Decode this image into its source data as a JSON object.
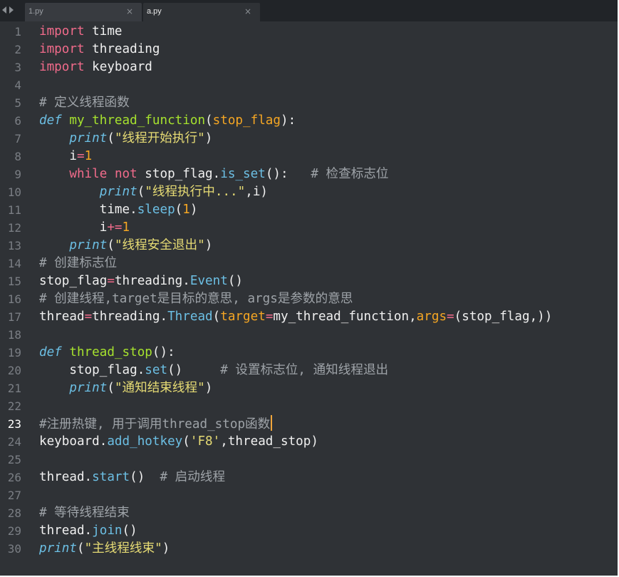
{
  "tabs": [
    {
      "label": "1.py",
      "close": "×"
    },
    {
      "label": "a.py",
      "close": "×"
    }
  ],
  "current_line": "23",
  "lines": {
    "l1": {
      "n": "1",
      "t": [
        [
          "kw",
          "import"
        ],
        [
          "pl",
          " time"
        ]
      ]
    },
    "l2": {
      "n": "2",
      "t": [
        [
          "kw",
          "import"
        ],
        [
          "pl",
          " threading"
        ]
      ]
    },
    "l3": {
      "n": "3",
      "t": [
        [
          "kw",
          "import"
        ],
        [
          "pl",
          " keyboard"
        ]
      ]
    },
    "l4": {
      "n": "4",
      "t": []
    },
    "l5": {
      "n": "5",
      "t": [
        [
          "cm",
          "# 定义线程函数"
        ]
      ]
    },
    "l6": {
      "n": "6",
      "t": [
        [
          "def",
          "def"
        ],
        [
          "pl",
          " "
        ],
        [
          "fn",
          "my_thread_function"
        ],
        [
          "pl",
          "("
        ],
        [
          "arg",
          "stop_flag"
        ],
        [
          "pl",
          "):"
        ]
      ]
    },
    "l7": {
      "n": "7",
      "t": [
        [
          "pl",
          "    "
        ],
        [
          "pr",
          "print"
        ],
        [
          "pl",
          "("
        ],
        [
          "str",
          "\"线程开始执行\""
        ],
        [
          "pl",
          ")"
        ]
      ]
    },
    "l8": {
      "n": "8",
      "t": [
        [
          "pl",
          "    i"
        ],
        [
          "op",
          "="
        ],
        [
          "num",
          "1"
        ]
      ]
    },
    "l9": {
      "n": "9",
      "t": [
        [
          "pl",
          "    "
        ],
        [
          "kw",
          "while"
        ],
        [
          "pl",
          " "
        ],
        [
          "kw",
          "not"
        ],
        [
          "pl",
          " stop_flag."
        ],
        [
          "mth",
          "is_set"
        ],
        [
          "pl",
          "():   "
        ],
        [
          "cm",
          "# 检查标志位"
        ]
      ]
    },
    "l10": {
      "n": "10",
      "t": [
        [
          "pl",
          "        "
        ],
        [
          "pr",
          "print"
        ],
        [
          "pl",
          "("
        ],
        [
          "str",
          "\"线程执行中...\""
        ],
        [
          "pl",
          ",i)"
        ]
      ]
    },
    "l11": {
      "n": "11",
      "t": [
        [
          "pl",
          "        time."
        ],
        [
          "mth",
          "sleep"
        ],
        [
          "pl",
          "("
        ],
        [
          "num",
          "1"
        ],
        [
          "pl",
          ")"
        ]
      ]
    },
    "l12": {
      "n": "12",
      "t": [
        [
          "pl",
          "        i"
        ],
        [
          "op",
          "+="
        ],
        [
          "num",
          "1"
        ]
      ]
    },
    "l13": {
      "n": "13",
      "t": [
        [
          "pl",
          "    "
        ],
        [
          "pr",
          "print"
        ],
        [
          "pl",
          "("
        ],
        [
          "str",
          "\"线程安全退出\""
        ],
        [
          "pl",
          ")"
        ]
      ]
    },
    "l14": {
      "n": "14",
      "t": [
        [
          "cm",
          "# 创建标志位"
        ]
      ]
    },
    "l15": {
      "n": "15",
      "t": [
        [
          "pl",
          "stop_flag"
        ],
        [
          "op",
          "="
        ],
        [
          "pl",
          "threading."
        ],
        [
          "cls",
          "Event"
        ],
        [
          "pl",
          "()"
        ]
      ]
    },
    "l16": {
      "n": "16",
      "t": [
        [
          "cm",
          "# 创建线程,target是目标的意思, args是参数的意思"
        ]
      ]
    },
    "l17": {
      "n": "17",
      "t": [
        [
          "pl",
          "thread"
        ],
        [
          "op",
          "="
        ],
        [
          "pl",
          "threading."
        ],
        [
          "cls",
          "Thread"
        ],
        [
          "pl",
          "("
        ],
        [
          "arg",
          "target"
        ],
        [
          "op",
          "="
        ],
        [
          "pl",
          "my_thread_function,"
        ],
        [
          "arg",
          "args"
        ],
        [
          "op",
          "="
        ],
        [
          "pl",
          "(stop_flag,))"
        ]
      ]
    },
    "l18": {
      "n": "18",
      "t": []
    },
    "l19": {
      "n": "19",
      "t": [
        [
          "def",
          "def"
        ],
        [
          "pl",
          " "
        ],
        [
          "fn",
          "thread_stop"
        ],
        [
          "pl",
          "():"
        ]
      ]
    },
    "l20": {
      "n": "20",
      "t": [
        [
          "pl",
          "    stop_flag."
        ],
        [
          "mth",
          "set"
        ],
        [
          "pl",
          "()     "
        ],
        [
          "cm",
          "# 设置标志位, 通知线程退出"
        ]
      ]
    },
    "l21": {
      "n": "21",
      "t": [
        [
          "pl",
          "    "
        ],
        [
          "pr",
          "print"
        ],
        [
          "pl",
          "("
        ],
        [
          "str",
          "\"通知结束线程\""
        ],
        [
          "pl",
          ")"
        ]
      ]
    },
    "l22": {
      "n": "22",
      "t": []
    },
    "l23": {
      "n": "23",
      "t": [
        [
          "cm",
          "#注册热键, 用于调用thread_stop函数"
        ]
      ]
    },
    "l24": {
      "n": "24",
      "t": [
        [
          "pl",
          "keyboard."
        ],
        [
          "mth",
          "add_hotkey"
        ],
        [
          "pl",
          "("
        ],
        [
          "str",
          "'F8'"
        ],
        [
          "pl",
          ",thread_stop)"
        ]
      ]
    },
    "l25": {
      "n": "25",
      "t": []
    },
    "l26": {
      "n": "26",
      "t": [
        [
          "pl",
          "thread."
        ],
        [
          "mth",
          "start"
        ],
        [
          "pl",
          "()  "
        ],
        [
          "cm",
          "# 启动线程"
        ]
      ]
    },
    "l27": {
      "n": "27",
      "t": []
    },
    "l28": {
      "n": "28",
      "t": [
        [
          "cm",
          "# 等待线程结束"
        ]
      ]
    },
    "l29": {
      "n": "29",
      "t": [
        [
          "pl",
          "thread."
        ],
        [
          "mth",
          "join"
        ],
        [
          "pl",
          "()"
        ]
      ]
    },
    "l30": {
      "n": "30",
      "t": [
        [
          "pr",
          "print"
        ],
        [
          "pl",
          "("
        ],
        [
          "str",
          "\"主线程线束\""
        ],
        [
          "pl",
          ")"
        ]
      ]
    }
  }
}
